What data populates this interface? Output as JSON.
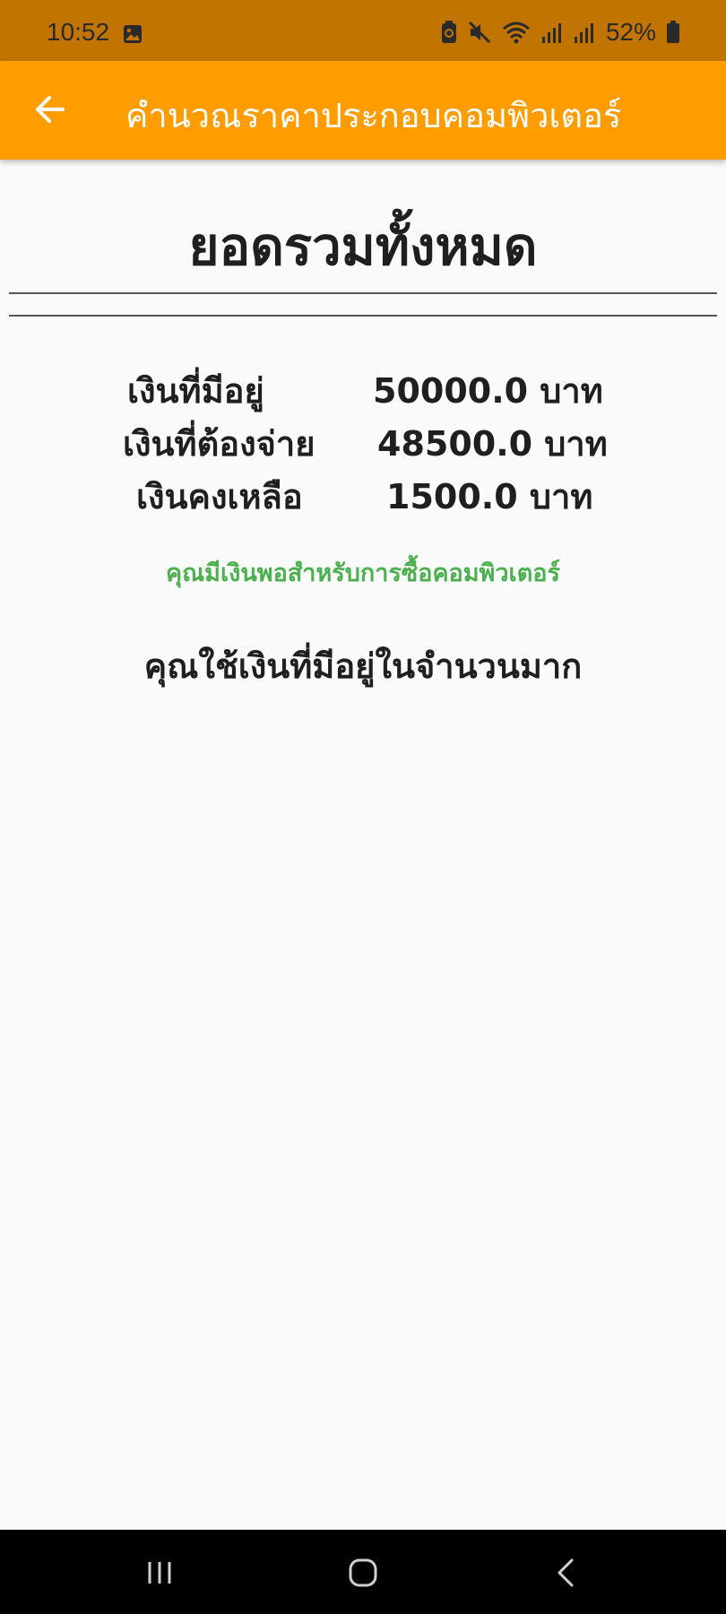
{
  "status_bar": {
    "time": "10:52",
    "battery": "52%",
    "icons": [
      "image-icon",
      "battery-saver-icon",
      "mute-icon",
      "wifi-icon",
      "signal-icon",
      "signal-icon",
      "battery-icon"
    ]
  },
  "app_bar": {
    "title": "คำนวณราคาประกอบคอมพิวเตอร์",
    "back_icon": "arrow-left-icon",
    "background": "#ff9c00"
  },
  "summary": {
    "heading": "ยอดรวมทั้งหมด",
    "rows": [
      {
        "label": "เงินที่มีอยู่",
        "value": "50000.0 บาท"
      },
      {
        "label": "เงินที่ต้องจ่าย",
        "value": "48500.0 บาท"
      },
      {
        "label": "เงินคงเหลือ",
        "value": "1500.0 บาท"
      }
    ],
    "status_message": "คุณมีเงินพอสำหรับการซื้อคอมพิวเตอร์",
    "status_color": "#4caf50",
    "comment": "คุณใช้เงินที่มีอยู่ในจำนวนมาก"
  },
  "nav_bar": {
    "buttons": [
      "recent-apps-icon",
      "home-icon",
      "back-icon"
    ]
  }
}
